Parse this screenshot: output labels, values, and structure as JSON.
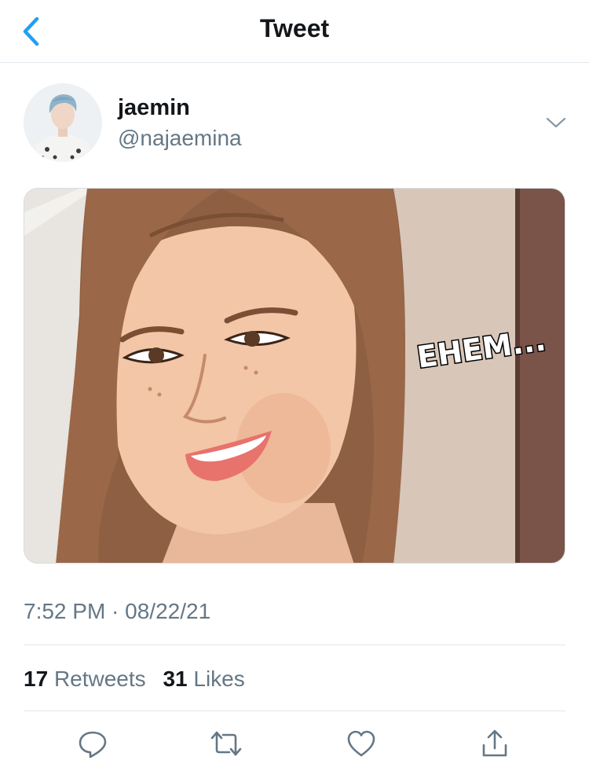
{
  "header": {
    "title": "Tweet",
    "back_icon": "chevron-left-icon"
  },
  "author": {
    "display_name": "jaemin",
    "handle": "@najaemina",
    "menu_icon": "chevron-down-icon"
  },
  "media": {
    "caption": "EHEM..."
  },
  "tweet": {
    "timestamp": "7:52 PM · 08/22/21",
    "retweet_count": "17",
    "retweet_label": "Retweets",
    "like_count": "31",
    "like_label": "Likes"
  },
  "actions": [
    {
      "icon": "reply-icon"
    },
    {
      "icon": "retweet-icon"
    },
    {
      "icon": "like-icon"
    },
    {
      "icon": "share-icon"
    }
  ],
  "colors": {
    "accent": "#1da1f2",
    "secondary_text": "#657786",
    "divider": "#e1e8ed"
  }
}
